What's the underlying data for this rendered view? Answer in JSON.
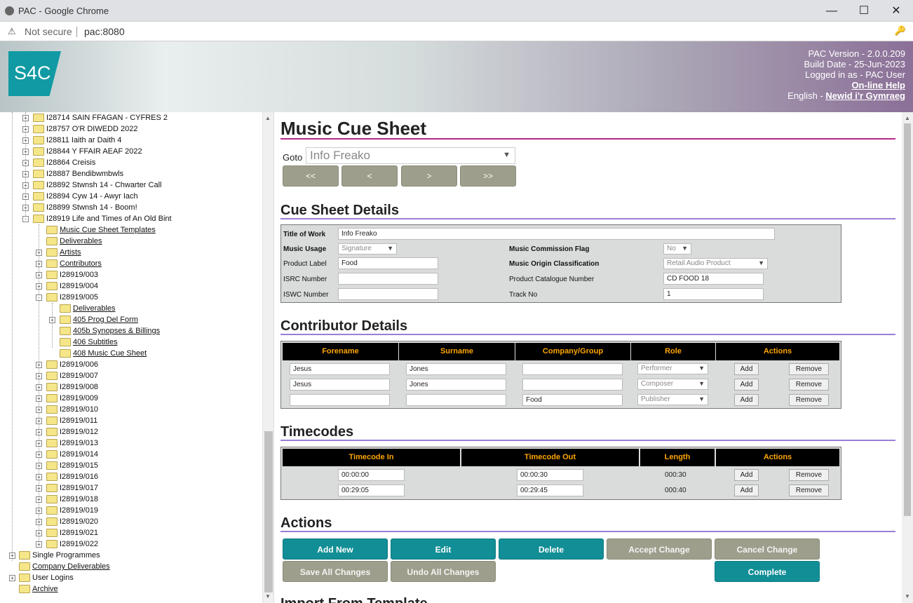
{
  "window": {
    "title": "PAC - Google Chrome",
    "minimize": "—",
    "maximize": "☐",
    "close": "✕"
  },
  "address": {
    "warning": "⚠",
    "not_secure": "Not secure",
    "url": "pac:8080",
    "key_icon": "🔑"
  },
  "banner": {
    "logo": "S4C",
    "version": "PAC Version - 2.0.0.209",
    "build_date": "Build Date - 25-Jun-2023",
    "logged_in": "Logged in as - PAC User",
    "help": "On-line Help",
    "lang_prefix": "English -",
    "lang_link": "Newid i'r Gymraeg"
  },
  "tree": {
    "nodes": [
      {
        "label": "I28714 SAIN FFAGAN - CYFRES 2",
        "u": false,
        "exp": "+"
      },
      {
        "label": "I28757 O'R DIWEDD 2022",
        "u": false,
        "exp": "+"
      },
      {
        "label": "I28811 Iaith ar Daith 4",
        "u": false,
        "exp": "+"
      },
      {
        "label": "I28844 Y FFAIR AEAF 2022",
        "u": false,
        "exp": "+"
      },
      {
        "label": "I28864 Creisis",
        "u": false,
        "exp": "+"
      },
      {
        "label": "I28887 Bendibwmbwls",
        "u": false,
        "exp": "+"
      },
      {
        "label": "I28892 Stwnsh 14 - Chwarter Call",
        "u": false,
        "exp": "+"
      },
      {
        "label": "I28894 Cyw 14 - Awyr Iach",
        "u": false,
        "exp": "+"
      },
      {
        "label": "I28899 Stwnsh 14 - Boom!",
        "u": false,
        "exp": "+"
      },
      {
        "label": "I28919 Life and Times of An Old Bint",
        "u": false,
        "exp": "-"
      },
      {
        "label": "Music Cue Sheet Templates",
        "u": true,
        "exp": ""
      },
      {
        "label": "Deliverables",
        "u": true,
        "exp": ""
      },
      {
        "label": "Artists",
        "u": true,
        "exp": "+"
      },
      {
        "label": "Contributors",
        "u": true,
        "exp": "+"
      },
      {
        "label": "I28919/003",
        "u": false,
        "exp": "+"
      },
      {
        "label": "I28919/004",
        "u": false,
        "exp": "+"
      },
      {
        "label": "I28919/005",
        "u": false,
        "exp": "-"
      },
      {
        "label": "Deliverables",
        "u": true,
        "exp": ""
      },
      {
        "label": "405 Prog Del Form",
        "u": true,
        "exp": "+"
      },
      {
        "label": "405b Synopses & Billings",
        "u": true,
        "exp": ""
      },
      {
        "label": "406 Subtitles",
        "u": true,
        "exp": ""
      },
      {
        "label": "408 Music Cue Sheet",
        "u": true,
        "exp": ""
      },
      {
        "label": "I28919/006",
        "u": false,
        "exp": "+"
      },
      {
        "label": "I28919/007",
        "u": false,
        "exp": "+"
      },
      {
        "label": "I28919/008",
        "u": false,
        "exp": "+"
      },
      {
        "label": "I28919/009",
        "u": false,
        "exp": "+"
      },
      {
        "label": "I28919/010",
        "u": false,
        "exp": "+"
      },
      {
        "label": "I28919/011",
        "u": false,
        "exp": "+"
      },
      {
        "label": "I28919/012",
        "u": false,
        "exp": "+"
      },
      {
        "label": "I28919/013",
        "u": false,
        "exp": "+"
      },
      {
        "label": "I28919/014",
        "u": false,
        "exp": "+"
      },
      {
        "label": "I28919/015",
        "u": false,
        "exp": "+"
      },
      {
        "label": "I28919/016",
        "u": false,
        "exp": "+"
      },
      {
        "label": "I28919/017",
        "u": false,
        "exp": "+"
      },
      {
        "label": "I28919/018",
        "u": false,
        "exp": "+"
      },
      {
        "label": "I28919/019",
        "u": false,
        "exp": "+"
      },
      {
        "label": "I28919/020",
        "u": false,
        "exp": "+"
      },
      {
        "label": "I28919/021",
        "u": false,
        "exp": "+"
      },
      {
        "label": "I28919/022",
        "u": false,
        "exp": "+"
      },
      {
        "label": "Single Programmes",
        "u": false,
        "exp": "+"
      },
      {
        "label": "Company Deliverables",
        "u": true,
        "exp": ""
      },
      {
        "label": "User Logins",
        "u": false,
        "exp": "+"
      },
      {
        "label": "Archive",
        "u": true,
        "exp": ""
      }
    ]
  },
  "page": {
    "title": "Music Cue Sheet",
    "goto_label": "Goto",
    "goto_value": "Info Freako",
    "nav": [
      "<<",
      "<",
      ">",
      ">>"
    ]
  },
  "cue": {
    "heading": "Cue Sheet Details",
    "title_label": "Title of Work",
    "title_value": "Info Freako",
    "usage_label": "Music Usage",
    "usage_value": "Signature",
    "commission_label": "Music Commission Flag",
    "commission_value": "No",
    "product_label": "Product Label",
    "product_value": "Food",
    "origin_label": "Music Origin Classification",
    "origin_value": "Retail Audio Product",
    "isrc_label": "ISRC Number",
    "isrc_value": "",
    "catalogue_label": "Product Catalogue Number",
    "catalogue_value": "CD FOOD 18",
    "iswc_label": "ISWC Number",
    "iswc_value": "",
    "track_label": "Track No",
    "track_value": "1"
  },
  "contrib": {
    "heading": "Contributor Details",
    "headers": [
      "Forename",
      "Surname",
      "Company/Group",
      "Role",
      "Actions"
    ],
    "rows": [
      {
        "forename": "Jesus",
        "surname": "Jones",
        "company": "",
        "role": "Performer"
      },
      {
        "forename": "Jesus",
        "surname": "Jones",
        "company": "",
        "role": "Composer"
      },
      {
        "forename": "",
        "surname": "",
        "company": "Food",
        "role": "Publisher"
      }
    ],
    "add": "Add",
    "remove": "Remove"
  },
  "timecodes": {
    "heading": "Timecodes",
    "headers": [
      "Timecode In",
      "Timecode Out",
      "Length",
      "Actions"
    ],
    "rows": [
      {
        "in": "00:00:00",
        "out": "00:00:30",
        "length": "000:30"
      },
      {
        "in": "00:29:05",
        "out": "00:29:45",
        "length": "000:40"
      }
    ],
    "add": "Add",
    "remove": "Remove"
  },
  "actions": {
    "heading": "Actions",
    "add_new": "Add New",
    "edit": "Edit",
    "delete": "Delete",
    "accept": "Accept Change",
    "cancel": "Cancel Change",
    "save_all": "Save All Changes",
    "undo_all": "Undo All Changes",
    "complete": "Complete",
    "next_heading": "Import From Template"
  }
}
